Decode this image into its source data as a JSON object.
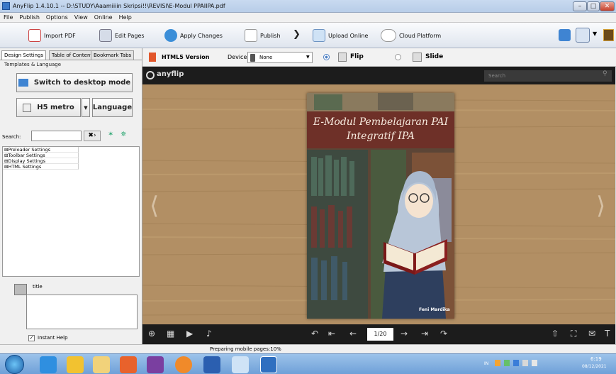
{
  "window": {
    "title": "AnyFlip 1.4.10.1 -- D:\\STUDY\\Aaamiiiin Skripsi!!\\REVISI\\E-Modul PPAIIPA.pdf",
    "controls": [
      "minimize",
      "maximize",
      "close"
    ]
  },
  "menu": [
    "File",
    "Publish",
    "Options",
    "View",
    "Online",
    "Help"
  ],
  "toolbar": {
    "import_pdf": "Import PDF",
    "edit_pages": "Edit Pages",
    "apply_changes": "Apply Changes",
    "publish": "Publish",
    "upload_online": "Upload Online",
    "cloud_platform": "Cloud Platform"
  },
  "left_panel": {
    "tabs": [
      "Design Settings",
      "Table of Contents",
      "Bookmark Tabs"
    ],
    "group_label": "Templates & Language",
    "switch_desktop": "Switch to desktop mode",
    "template": "H5 metro",
    "language": "Language",
    "search_label": "Search:",
    "search_value": "",
    "tree": [
      "⊞Preloader Settings",
      "⊞Toolbar Settings",
      "⊞Display Settings",
      "⊞HTML Settings"
    ],
    "help_title": "title",
    "instant_help": "Instant Help"
  },
  "subtoolbar": {
    "version": "HTML5 Version",
    "device_label": "Device:",
    "device_value": "None",
    "flip": "Flip",
    "slide": "Slide"
  },
  "viewer": {
    "logo": "anyflip",
    "search_placeholder": "Search",
    "page_indicator": "1/20"
  },
  "book": {
    "title_line1": "E-Modul Pembelajaran PAI",
    "title_line2": "Integratif IPA",
    "author": "Feni Mardika"
  },
  "status": "Preparing mobile pages:10%",
  "taskbar": {
    "lang": "IN",
    "time": "6:19",
    "date": "08/12/2021"
  },
  "colors": {
    "viewer_bg": "#b28f64",
    "bar_dark": "#1c1c1c",
    "book_title_band": "#6e3028"
  }
}
